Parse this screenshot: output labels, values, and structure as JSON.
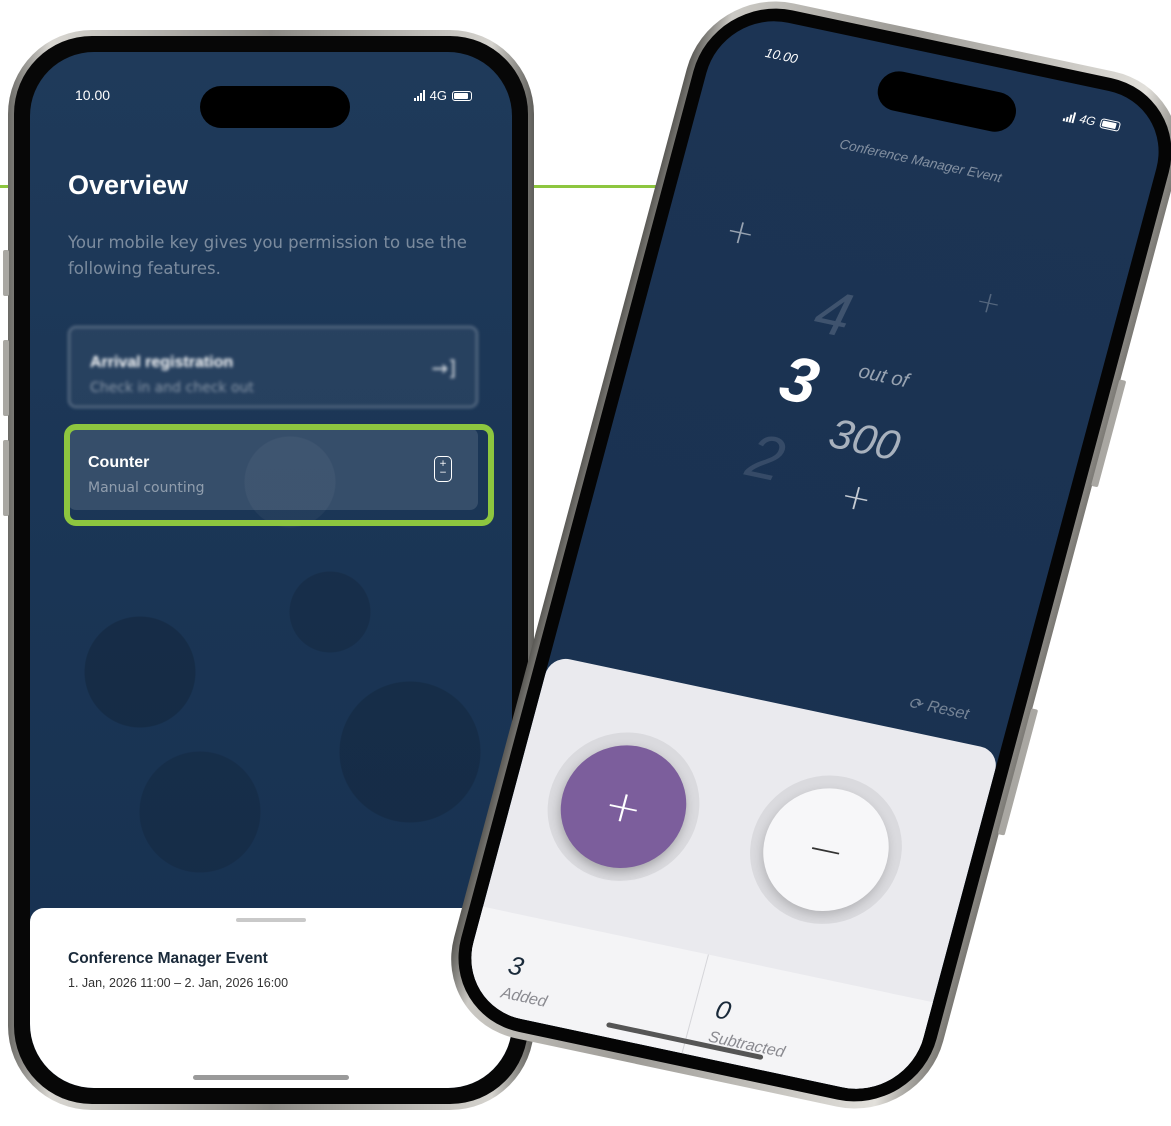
{
  "status_bar": {
    "time": "10.00",
    "network": "4G"
  },
  "overview": {
    "title": "Overview",
    "description": "Your mobile key gives you permission to use the following features.",
    "features": [
      {
        "title": "Arrival registration",
        "subtitle": "Check in and check out",
        "icon": "arrow-login-icon"
      },
      {
        "title": "Counter",
        "subtitle": "Manual counting",
        "icon": "counter-icon"
      }
    ],
    "event": {
      "name": "Conference Manager Event",
      "dates": "1. Jan, 2026 11:00  –  2. Jan, 2026 16:00"
    }
  },
  "counter_screen": {
    "event_name": "Conference Manager Event",
    "previous_number": "4",
    "current": "3",
    "next_number": "2",
    "out_of_label": "out of",
    "capacity": "300",
    "reset_label": "Reset",
    "add_symbol": "+",
    "subtract_symbol": "−",
    "added_value": "3",
    "added_label": "Added",
    "subtracted_value": "0",
    "subtracted_label": "Subtracted"
  },
  "colors": {
    "accent_green": "#8dc63f",
    "screen_navy": "#1c3454",
    "add_purple": "#7c5e9c"
  }
}
